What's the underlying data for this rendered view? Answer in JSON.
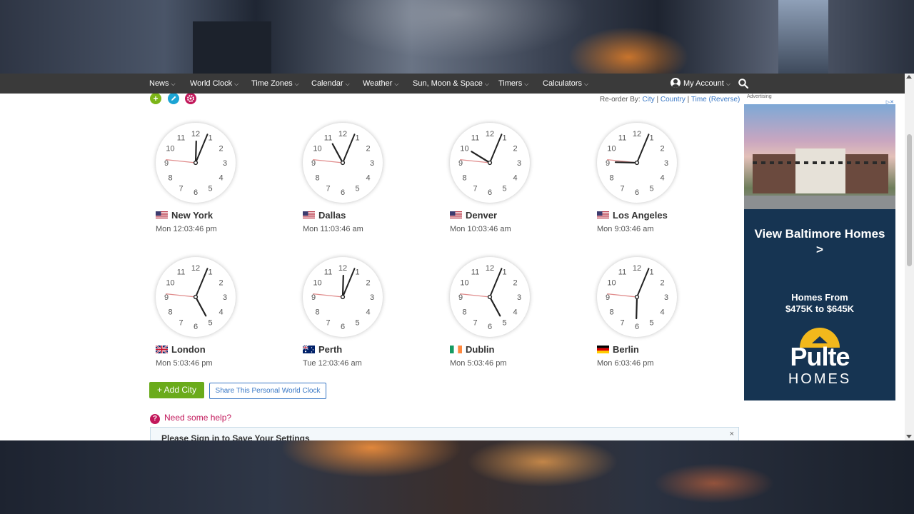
{
  "nav": {
    "items": [
      {
        "label": "News"
      },
      {
        "label": "World Clock"
      },
      {
        "label": "Time Zones"
      },
      {
        "label": "Calendar"
      },
      {
        "label": "Weather"
      },
      {
        "label": "Sun, Moon & Space"
      },
      {
        "label": "Timers"
      },
      {
        "label": "Calculators"
      }
    ],
    "account_label": "My Account",
    "chevron": "⌵"
  },
  "toolbar": {
    "add_symbol": "+",
    "edit_icon": "pencil-icon",
    "settings_icon": "gear-icon",
    "colors": {
      "add": "#7cb518",
      "edit": "#1ba4d4",
      "settings": "#c2185b"
    }
  },
  "reorder": {
    "label": "Re-order By:",
    "options": [
      "City",
      "Country",
      "Time (Reverse)"
    ],
    "separator": " | "
  },
  "clocks": [
    {
      "city": "New York",
      "time": "Mon 12:03:46 pm",
      "flag": "us",
      "hour": 12,
      "minute": 3,
      "second": 46
    },
    {
      "city": "Dallas",
      "time": "Mon 11:03:46 am",
      "flag": "us",
      "hour": 11,
      "minute": 3,
      "second": 46
    },
    {
      "city": "Denver",
      "time": "Mon 10:03:46 am",
      "flag": "us",
      "hour": 10,
      "minute": 3,
      "second": 46
    },
    {
      "city": "Los Angeles",
      "time": "Mon 9:03:46 am",
      "flag": "us",
      "hour": 9,
      "minute": 3,
      "second": 46
    },
    {
      "city": "London",
      "time": "Mon 5:03:46 pm",
      "flag": "uk",
      "hour": 5,
      "minute": 3,
      "second": 46
    },
    {
      "city": "Perth",
      "time": "Tue 12:03:46 am",
      "flag": "au",
      "hour": 12,
      "minute": 3,
      "second": 46
    },
    {
      "city": "Dublin",
      "time": "Mon 5:03:46 pm",
      "flag": "ie",
      "hour": 5,
      "minute": 3,
      "second": 46
    },
    {
      "city": "Berlin",
      "time": "Mon 6:03:46 pm",
      "flag": "de",
      "hour": 6,
      "minute": 3,
      "second": 46
    }
  ],
  "dial_numbers": [
    "12",
    "1",
    "2",
    "3",
    "4",
    "5",
    "6",
    "7",
    "8",
    "9",
    "10",
    "11"
  ],
  "actions": {
    "add_city": "+ Add City",
    "share": "Share This Personal World Clock"
  },
  "help": {
    "icon": "?",
    "text": "Need some help?"
  },
  "signin": {
    "text": "Please Sign in to Save Your Settings",
    "close": "×"
  },
  "ad": {
    "label": "Advertising",
    "close": "▷✕",
    "headline": "View Baltimore Homes",
    "headline_arrow": ">",
    "sub_line1": "Homes From",
    "sub_line2": "$475K to $645K",
    "brand_line1": "Pulte",
    "brand_line2": "HOMES"
  }
}
